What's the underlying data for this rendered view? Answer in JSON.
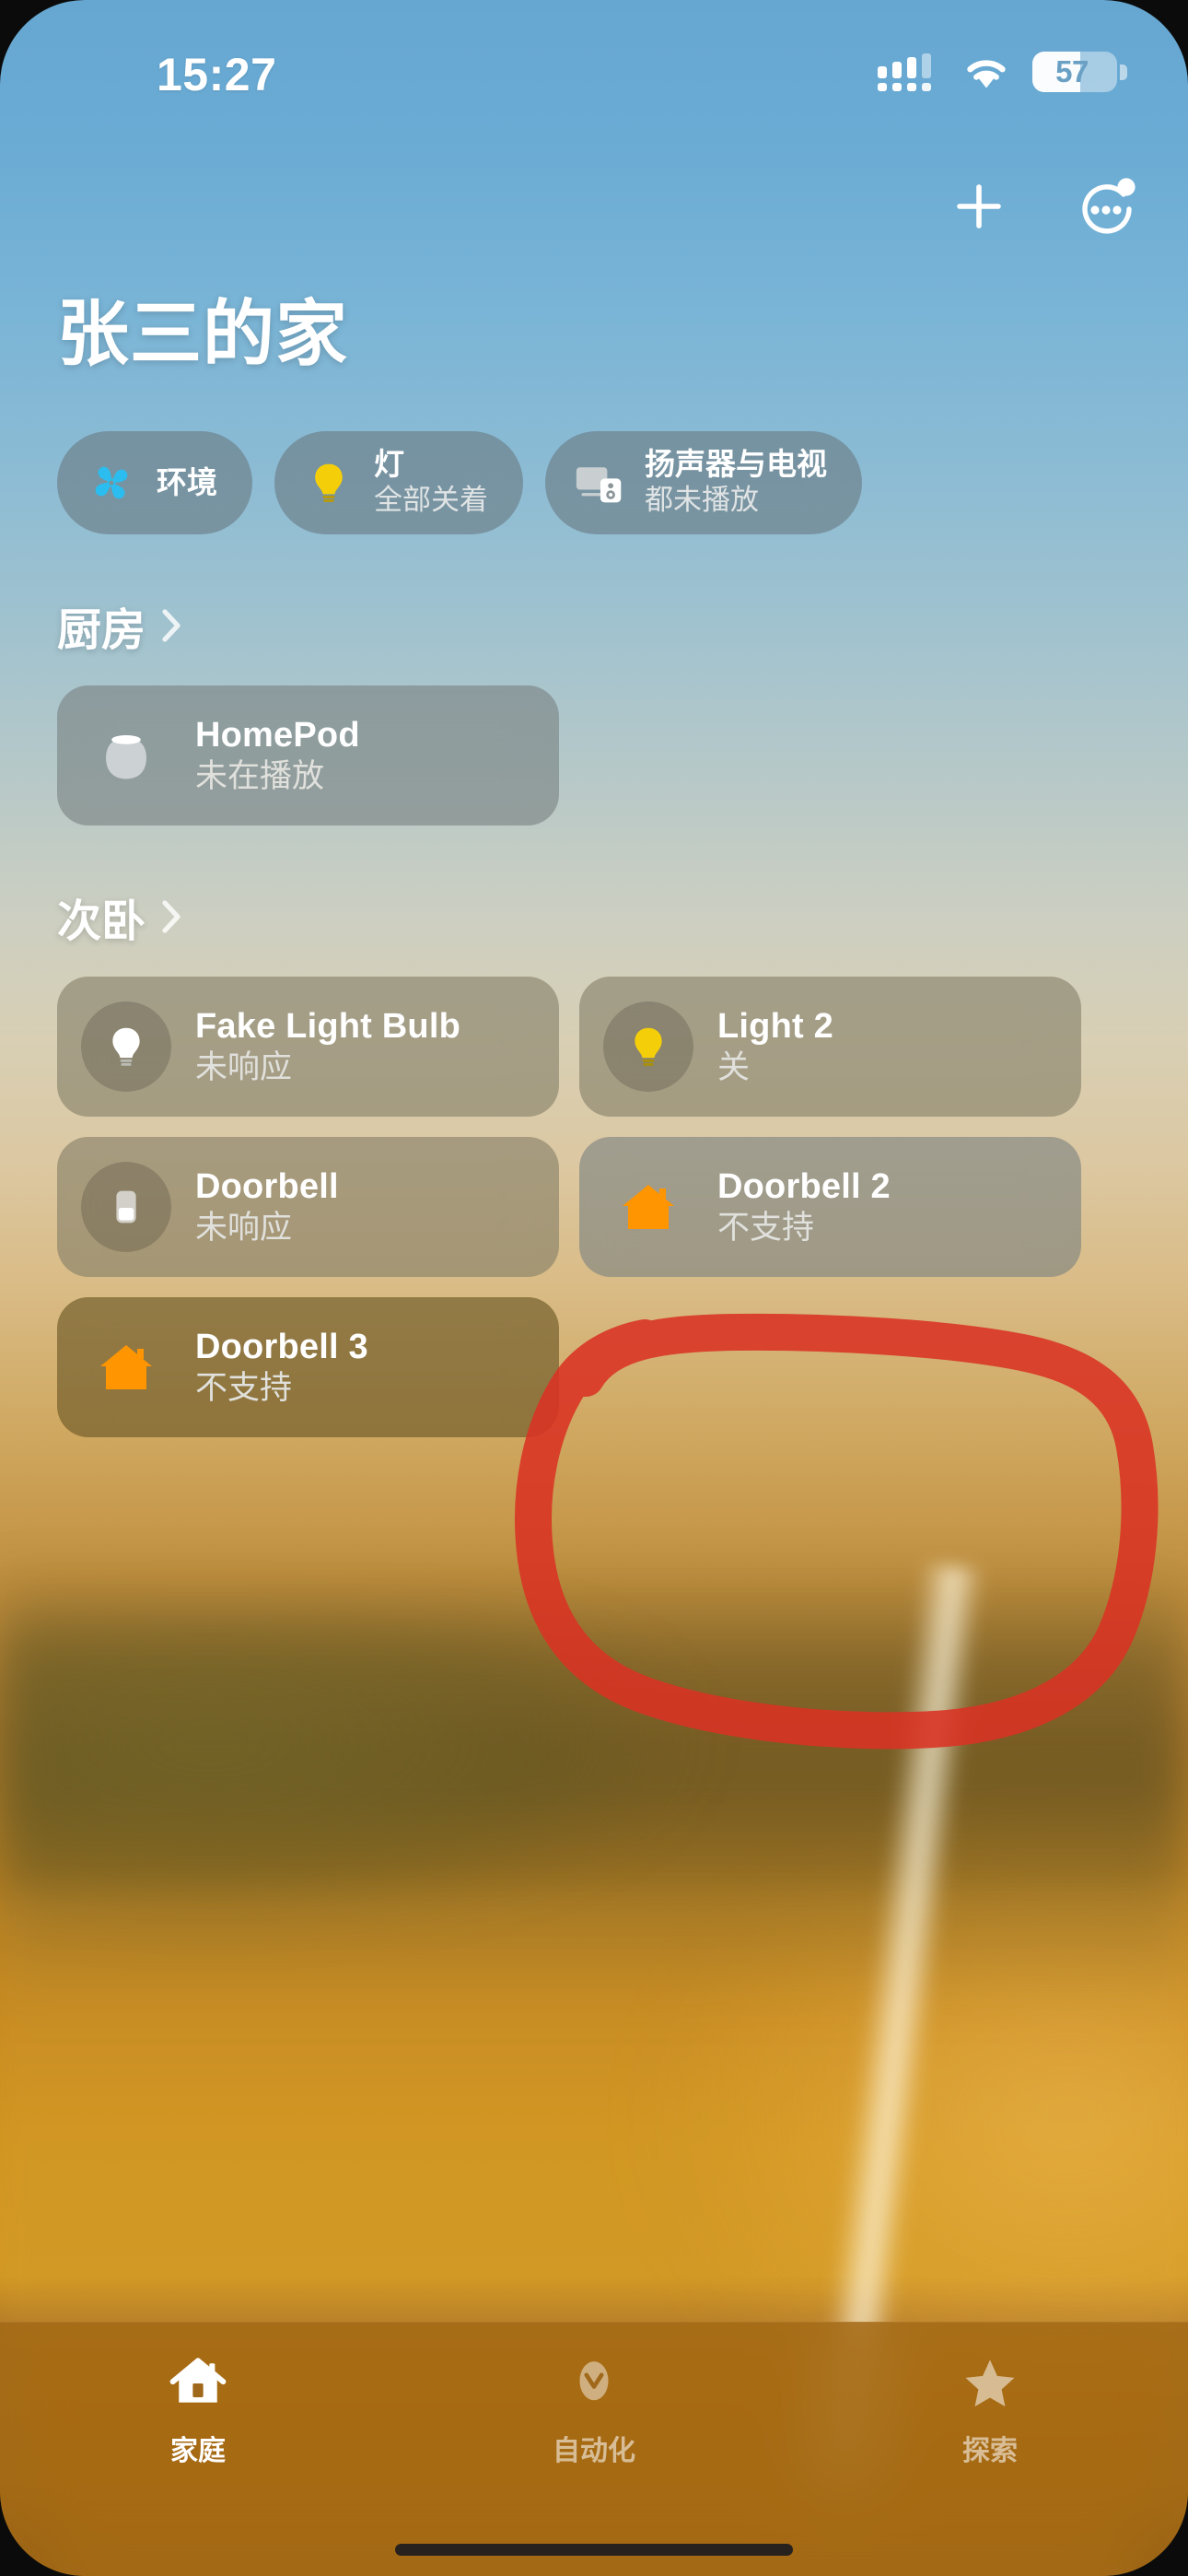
{
  "status_bar": {
    "time": "15:27",
    "battery_percent": "57",
    "cellular_icon": "cellular-bars-icon",
    "wifi_icon": "wifi-icon",
    "battery_icon": "battery-icon"
  },
  "nav": {
    "add_label": "+",
    "add_icon": "plus-icon",
    "more_icon": "more-circle-icon"
  },
  "header": {
    "home_name": "张三的家"
  },
  "categories": [
    {
      "title": "环境",
      "subtitle": "",
      "icon": "fan-icon"
    },
    {
      "title": "灯",
      "subtitle": "全部关着",
      "icon": "lightbulb-icon"
    },
    {
      "title": "扬声器与电视",
      "subtitle": "都未播放",
      "icon": "speaker-tv-icon"
    }
  ],
  "rooms": [
    {
      "name": "厨房",
      "chevron_icon": "chevron-right-icon",
      "accessories": [
        {
          "name": "HomePod",
          "status": "未在播放",
          "icon": "homepod-icon",
          "tone": "grey"
        }
      ]
    },
    {
      "name": "次卧",
      "chevron_icon": "chevron-right-icon",
      "accessories": [
        {
          "name": "Fake Light Bulb",
          "status": "未响应",
          "icon": "lightbulb-white-icon",
          "tone": "warm"
        },
        {
          "name": "Light 2",
          "status": "关",
          "icon": "lightbulb-yellow-icon",
          "tone": "warm"
        },
        {
          "name": "Doorbell",
          "status": "未响应",
          "icon": "doorbell-icon",
          "tone": "warm"
        },
        {
          "name": "Doorbell 2",
          "status": "不支持",
          "icon": "house-orange-icon",
          "tone": "grey"
        },
        {
          "name": "Doorbell 3",
          "status": "不支持",
          "icon": "house-orange-icon",
          "tone": "dim"
        }
      ]
    }
  ],
  "annotation": {
    "shape": "hand-drawn-circle",
    "color": "#d93223",
    "target": "Doorbell 2"
  },
  "tabs": [
    {
      "label": "家庭",
      "icon": "house-icon",
      "active": true
    },
    {
      "label": "自动化",
      "icon": "automation-icon",
      "active": false
    },
    {
      "label": "探索",
      "icon": "star-icon",
      "active": false
    }
  ],
  "colors": {
    "accent_orange": "#FF9500",
    "bulb_yellow": "#F5CE0A",
    "fan_blue": "#2BBDEF",
    "annotation_red": "#d93223",
    "tabbar": "#a06816"
  }
}
